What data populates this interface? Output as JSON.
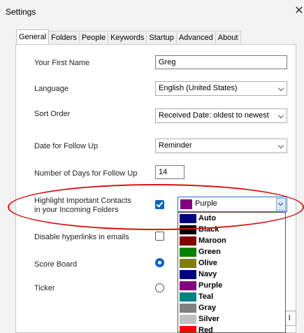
{
  "window": {
    "title": "Settings",
    "close_glyph": "✕"
  },
  "tabs": [
    "General",
    "Folders",
    "People",
    "Keywords",
    "Startup",
    "Advanced",
    "About"
  ],
  "fields": {
    "first_name_label": "Your First Name",
    "first_name_value": "Greg",
    "language_label": "Language",
    "language_value": "English (United States)",
    "sort_label": "Sort Order",
    "sort_value": "Received Date: oldest to newest",
    "followup_label": "Date for Follow Up",
    "followup_value": "Reminder",
    "days_label": "Number of Days for Follow Up",
    "days_value": "14",
    "highlight_label_1": "Highlight  Important  Contacts",
    "highlight_label_2": "in your Incoming Folders",
    "highlight_checked": true,
    "highlight_color": "Purple",
    "disable_links_label": "Disable hyperlinks in emails",
    "disable_links_checked": false,
    "scoreboard_label": "Score Board",
    "ticker_label": "Ticker"
  },
  "color_options": [
    {
      "name": "Auto",
      "color": "#00007f"
    },
    {
      "name": "Black",
      "color": "#000000"
    },
    {
      "name": "Maroon",
      "color": "#800000"
    },
    {
      "name": "Green",
      "color": "#008000"
    },
    {
      "name": "Olive",
      "color": "#808000"
    },
    {
      "name": "Navy",
      "color": "#000080"
    },
    {
      "name": "Purple",
      "color": "#800080"
    },
    {
      "name": "Teal",
      "color": "#008080"
    },
    {
      "name": "Gray",
      "color": "#808080"
    },
    {
      "name": "Silver",
      "color": "#c0c0c0"
    },
    {
      "name": "Red",
      "color": "#ff0000"
    }
  ],
  "buttons": {
    "ok_partial": "l"
  },
  "colors": {
    "accent": "#0a63c4",
    "annotation": "#d41414"
  }
}
